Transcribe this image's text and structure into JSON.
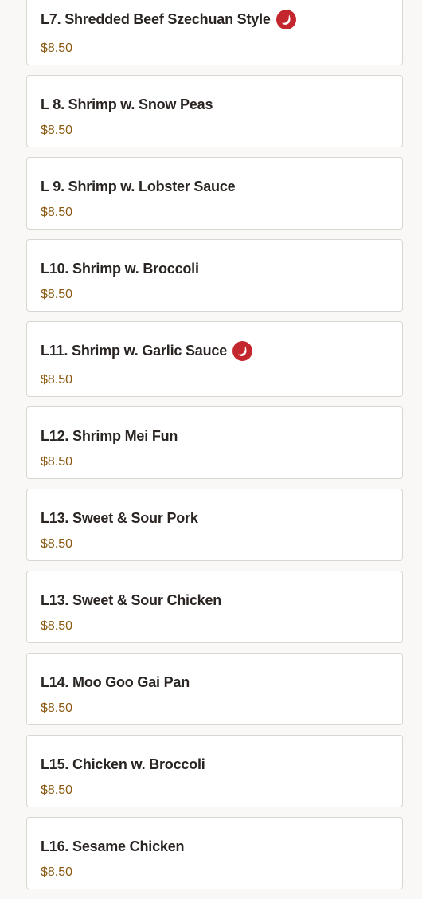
{
  "colors": {
    "price": "#8a5a12",
    "name": "#2a2522",
    "spicy_icon": "#c4262e",
    "card_border": "#d9d6d2",
    "background": "#f9f8f6"
  },
  "spicy_icon_name": "chili-pepper-icon",
  "items": [
    {
      "name": "L7. Shredded Beef Szechuan Style",
      "price": "$8.50",
      "spicy": true
    },
    {
      "name": "L 8. Shrimp w. Snow Peas",
      "price": "$8.50",
      "spicy": false
    },
    {
      "name": "L 9. Shrimp w. Lobster Sauce",
      "price": "$8.50",
      "spicy": false
    },
    {
      "name": "L10. Shrimp w. Broccoli",
      "price": "$8.50",
      "spicy": false
    },
    {
      "name": "L11. Shrimp w. Garlic Sauce",
      "price": "$8.50",
      "spicy": true
    },
    {
      "name": "L12. Shrimp Mei Fun",
      "price": "$8.50",
      "spicy": false
    },
    {
      "name": "L13. Sweet & Sour Pork",
      "price": "$8.50",
      "spicy": false
    },
    {
      "name": "L13. Sweet & Sour Chicken",
      "price": "$8.50",
      "spicy": false
    },
    {
      "name": "L14. Moo Goo Gai Pan",
      "price": "$8.50",
      "spicy": false
    },
    {
      "name": "L15. Chicken w. Broccoli",
      "price": "$8.50",
      "spicy": false
    },
    {
      "name": "L16. Sesame Chicken",
      "price": "$8.50",
      "spicy": false
    }
  ]
}
